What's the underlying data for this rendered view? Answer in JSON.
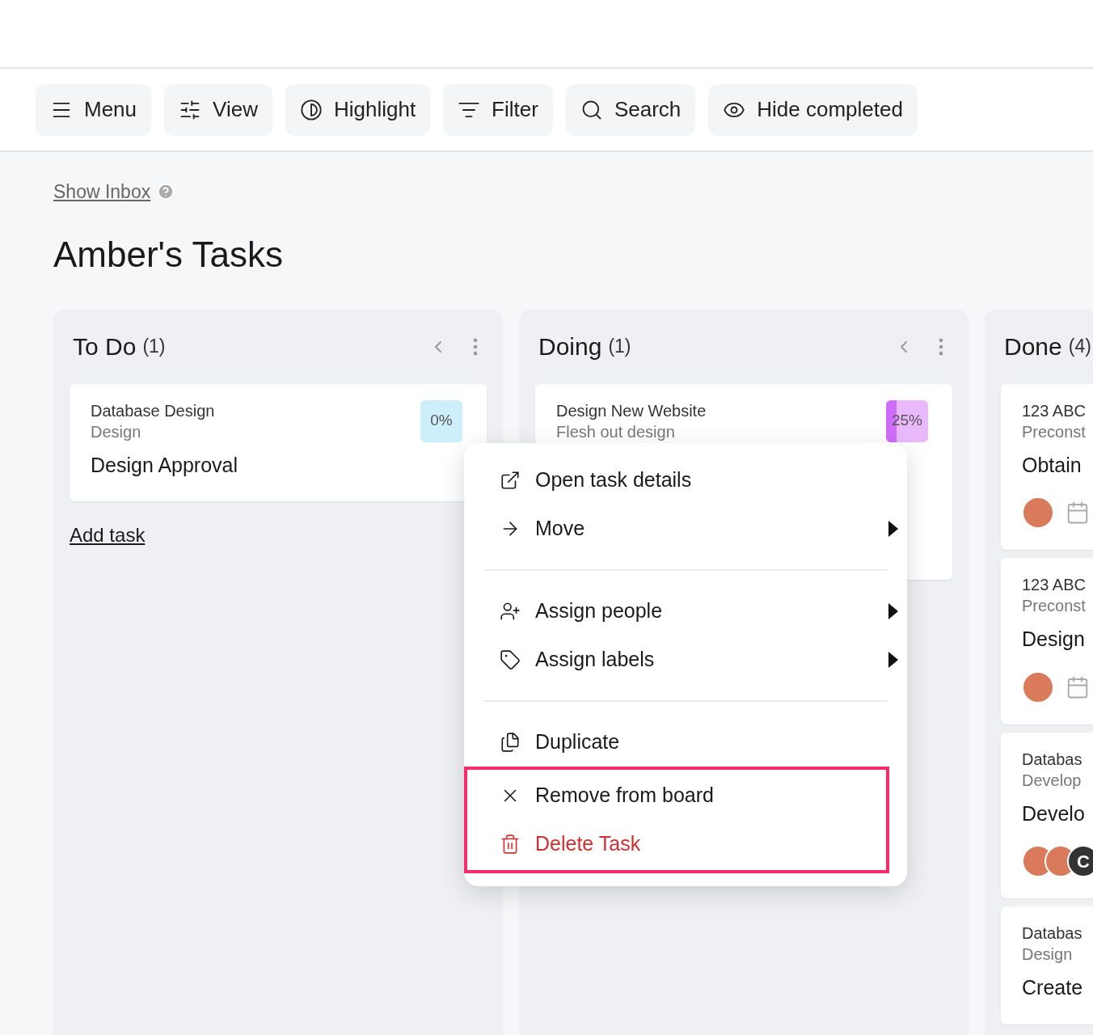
{
  "toolbar": [
    {
      "kind": "menu",
      "label": "Menu"
    },
    {
      "kind": "view",
      "label": "View"
    },
    {
      "kind": "highlight",
      "label": "Highlight"
    },
    {
      "kind": "filter",
      "label": "Filter"
    },
    {
      "kind": "search",
      "label": "Search"
    },
    {
      "kind": "hide",
      "label": "Hide completed"
    }
  ],
  "inbox_link": "Show Inbox",
  "title": "Amber's Tasks",
  "columns": [
    {
      "name": "To Do",
      "count": "(1)",
      "add_task": "Add task",
      "cards": [
        {
          "project": "Database Design",
          "section": "Design",
          "title": "Design Approval",
          "badge": {
            "text": "0%",
            "level": 0,
            "color": "#cdeefb"
          }
        }
      ]
    },
    {
      "name": "Doing",
      "count": "(1)",
      "cards": [
        {
          "project": "Design New Website",
          "section": "Flesh out design",
          "badge": {
            "text": "25%",
            "level": 0.25,
            "color": "#e9b9fb"
          }
        }
      ]
    },
    {
      "name": "Done",
      "count": "(4)",
      "cards": [
        {
          "project": "123 ABC",
          "section": "Preconst",
          "title": "Obtain",
          "avatars": [
            {
              "kind": "photo"
            }
          ],
          "due": true
        },
        {
          "project": "123 ABC",
          "section": "Preconst",
          "title": "Design",
          "avatars": [
            {
              "kind": "photo"
            }
          ],
          "due": true
        },
        {
          "project": "Databas",
          "section": "Develop",
          "title": "Develo",
          "avatars": [
            {
              "kind": "photo"
            },
            {
              "kind": "photo"
            },
            {
              "kind": "initial",
              "text": "C"
            }
          ]
        },
        {
          "project": "Databas",
          "section": "Design",
          "title": "Create"
        }
      ]
    }
  ],
  "context_menu": [
    [
      {
        "kind": "open",
        "label": "Open task details",
        "submenu": false,
        "highlighted": false
      },
      {
        "kind": "move",
        "label": "Move",
        "submenu": true,
        "highlighted": false
      }
    ],
    [
      {
        "kind": "people",
        "label": "Assign people",
        "submenu": true,
        "highlighted": false
      },
      {
        "kind": "labels",
        "label": "Assign labels",
        "submenu": true,
        "highlighted": false
      }
    ],
    [
      {
        "kind": "duplicate",
        "label": "Duplicate",
        "submenu": false,
        "highlighted": false
      },
      {
        "kind": "remove",
        "label": "Remove from board",
        "submenu": false,
        "highlighted": true
      },
      {
        "kind": "delete",
        "label": "Delete Task",
        "submenu": false,
        "highlighted": true
      }
    ]
  ]
}
